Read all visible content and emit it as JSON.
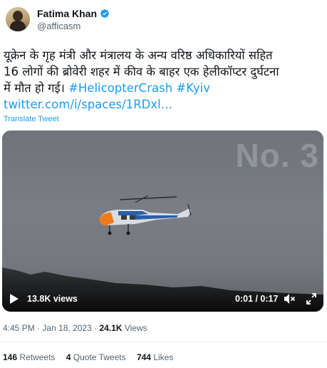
{
  "user": {
    "display_name": "Fatima Khan",
    "handle": "@afficasm",
    "verified": true
  },
  "tweet": {
    "line1": "यूक्रेन के गृह मंत्री और मंत्रालय के अन्य वरिष्ठ अधिकारियों सहित",
    "line2": "16 लोगों की ब्रोवेरी शहर में कीव के बाहर एक हेलीकॉप्टर दुर्घटना",
    "line3_text": "में मौत हो गई। ",
    "hashtag1": "#HelicopterCrash",
    "hashtag2": "#Kyiv",
    "link": "twitter.com/i/spaces/1RDxl…",
    "translate_label": "Translate Tweet"
  },
  "video": {
    "watermark": "No. 3",
    "views": "13.8K views",
    "time": "0:01 / 0:17",
    "progress": 0.06
  },
  "meta": {
    "time": "4:45 PM",
    "date": "Jan 18, 2023",
    "views_count": "24.1K",
    "views_label": "Views"
  },
  "stats": {
    "retweets_count": "146",
    "retweets_label": "Retweets",
    "quotes_count": "4",
    "quotes_label": "Quote Tweets",
    "likes_count": "744",
    "likes_label": "Likes"
  },
  "colors": {
    "accent": "#1d9bf0",
    "text": "#0f1419",
    "secondary": "#536471"
  }
}
